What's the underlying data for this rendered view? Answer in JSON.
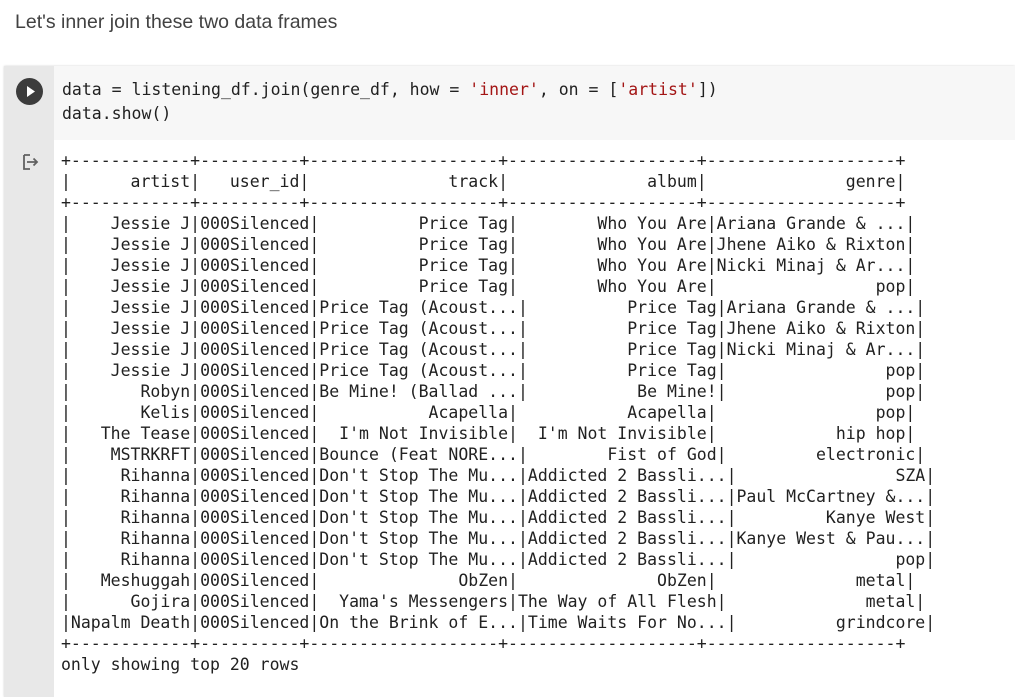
{
  "markdown_cell": {
    "text": "Let's inner join these two data frames"
  },
  "code_cell": {
    "code_lines": [
      {
        "segments": [
          {
            "text": "data = listening_df.join(genre_df, how = ",
            "type": "plain"
          },
          {
            "text": "'inner'",
            "type": "str"
          },
          {
            "text": ", on = [",
            "type": "plain"
          },
          {
            "text": "'artist'",
            "type": "str"
          },
          {
            "text": "])",
            "type": "plain"
          }
        ]
      },
      {
        "segments": [
          {
            "text": "data.show()",
            "type": "plain"
          }
        ]
      }
    ],
    "run_icon": "play-icon",
    "output_icon": "output-redirect-icon"
  },
  "output": {
    "columns": [
      "artist",
      "user_id",
      "track",
      "album",
      "genre"
    ],
    "widths": [
      12,
      10,
      19,
      19,
      19
    ],
    "align": [
      "right",
      "right",
      "right",
      "right",
      "right"
    ],
    "rows": [
      [
        "Jessie J",
        "000Silenced",
        "Price Tag",
        "Who You Are",
        "Ariana Grande & ..."
      ],
      [
        "Jessie J",
        "000Silenced",
        "Price Tag",
        "Who You Are",
        "Jhene Aiko & Rixton"
      ],
      [
        "Jessie J",
        "000Silenced",
        "Price Tag",
        "Who You Are",
        "Nicki Minaj & Ar..."
      ],
      [
        "Jessie J",
        "000Silenced",
        "Price Tag",
        "Who You Are",
        "pop"
      ],
      [
        "Jessie J",
        "000Silenced",
        "Price Tag (Acoust...",
        "Price Tag",
        "Ariana Grande & ..."
      ],
      [
        "Jessie J",
        "000Silenced",
        "Price Tag (Acoust...",
        "Price Tag",
        "Jhene Aiko & Rixton"
      ],
      [
        "Jessie J",
        "000Silenced",
        "Price Tag (Acoust...",
        "Price Tag",
        "Nicki Minaj & Ar..."
      ],
      [
        "Jessie J",
        "000Silenced",
        "Price Tag (Acoust...",
        "Price Tag",
        "pop"
      ],
      [
        "Robyn",
        "000Silenced",
        "Be Mine! (Ballad ...",
        "Be Mine!",
        "pop"
      ],
      [
        "Kelis",
        "000Silenced",
        "Acapella",
        "Acapella",
        "pop"
      ],
      [
        "The Tease",
        "000Silenced",
        "I'm Not Invisible",
        "I'm Not Invisible",
        "hip hop"
      ],
      [
        "MSTRKRFT",
        "000Silenced",
        "Bounce (Feat NORE...",
        "Fist of God",
        "electronic"
      ],
      [
        "Rihanna",
        "000Silenced",
        "Don't Stop The Mu...",
        "Addicted 2 Bassli...",
        "SZA"
      ],
      [
        "Rihanna",
        "000Silenced",
        "Don't Stop The Mu...",
        "Addicted 2 Bassli...",
        "Paul McCartney &..."
      ],
      [
        "Rihanna",
        "000Silenced",
        "Don't Stop The Mu...",
        "Addicted 2 Bassli...",
        "Kanye West"
      ],
      [
        "Rihanna",
        "000Silenced",
        "Don't Stop The Mu...",
        "Addicted 2 Bassli...",
        "Kanye West & Pau..."
      ],
      [
        "Rihanna",
        "000Silenced",
        "Don't Stop The Mu...",
        "Addicted 2 Bassli...",
        "pop"
      ],
      [
        "Meshuggah",
        "000Silenced",
        "ObZen",
        "ObZen",
        "metal"
      ],
      [
        "Gojira",
        "000Silenced",
        "Yama's Messengers",
        "The Way of All Flesh",
        "metal"
      ],
      [
        "Napalm Death",
        "000Silenced",
        "On the Brink of E...",
        "Time Waits For No...",
        "grindcore"
      ]
    ],
    "footer": "only showing top 20 rows"
  }
}
